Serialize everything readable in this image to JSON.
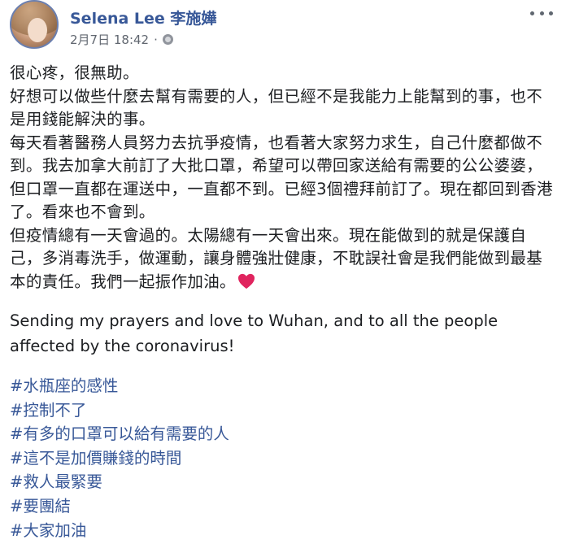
{
  "author": {
    "name": "Selena Lee 李施嬅",
    "timestamp": "2月7日 18:42",
    "separator": "·"
  },
  "icons": {
    "privacy": "globe-icon",
    "menu": "more-options-icon",
    "heart": "red-heart-icon"
  },
  "colors": {
    "link": "#385898",
    "text": "#1c1e21",
    "meta": "#616770",
    "heart": "#e0245e"
  },
  "post": {
    "paragraphs": [
      "很心疼，很無助。",
      "好想可以做些什麼去幫有需要的人，但已經不是我能力上能幫到的事，也不是用錢能解決的事。",
      "每天看著醫務人員努力去抗爭疫情，也看著大家努力求生，自己什麼都做不到。我去加拿大前訂了大批口罩，希望可以帶回家送給有需要的公公婆婆，但口罩一直都在運送中，一直都不到。已經3個禮拜前訂了。現在都回到香港了。看來也不會到。",
      "但疫情總有一天會過的。太陽總有一天會出來。現在能做到的就是保護自己，多消毒洗手，做運動，讓身體強壯健康，不耽誤社會是我們能做到最基本的責任。我們一起振作加油。"
    ],
    "english": "Sending my prayers and love to Wuhan, and to all the people affected by the coronavirus!",
    "hashtags": [
      "#水瓶座的感性",
      "#控制不了",
      "#有多的口罩可以給有需要的人",
      "#這不是加價賺錢的時間",
      "#救人最緊要",
      "#要團結",
      "#大家加油"
    ]
  }
}
